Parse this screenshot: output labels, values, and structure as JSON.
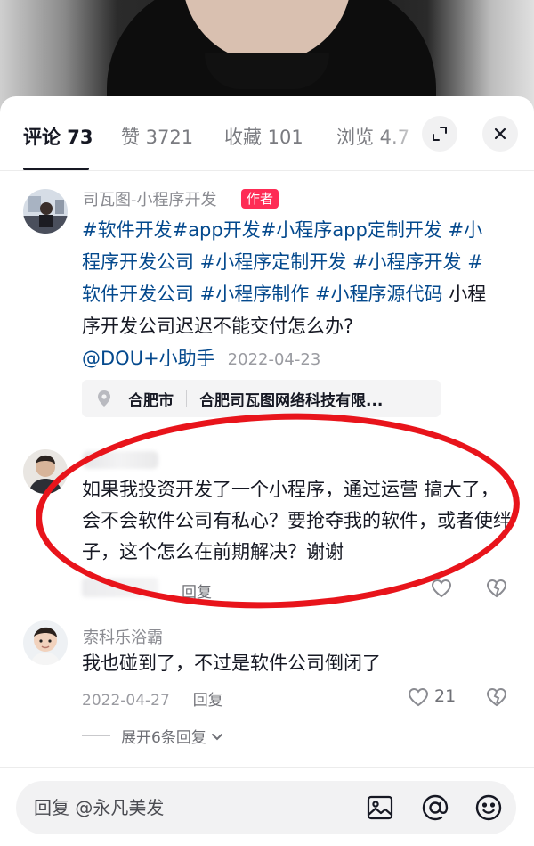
{
  "tabs": {
    "comments": "评论 73",
    "likes": "赞 3721",
    "favorites": "收藏 101",
    "views": "浏览 4.7"
  },
  "post": {
    "author": "司瓦图-小程序开发",
    "badge": "作者",
    "tags": "#软件开发#app开发#小程序app定制开发 #小程序开发公司 #小程序定制开发 #小程序开发 #软件开发公司 #小程序制作 #小程序源代码",
    "text": " 小程序开发公司迟迟不能交付怎么办?",
    "mention": "@DOU+小助手",
    "date": "2022-04-23",
    "location_city": "合肥市",
    "location_name": "合肥司瓦图网络科技有限..."
  },
  "comments": [
    {
      "text": "如果我投资开发了一个小程序，通过运营 搞大了，会不会软件公司有私心？要抢夺我的软件，或者使绊子，这个怎么在前期解决？谢谢",
      "reply_label": "回复"
    },
    {
      "user": "索科乐浴霸",
      "text": "我也碰到了，不过是软件公司倒闭了",
      "date": "2022-04-27",
      "reply_label": "回复",
      "likes": "21"
    }
  ],
  "expand_label": "展开6条回复",
  "input": {
    "placeholder": "回复 @永凡美发"
  },
  "colors": {
    "accent": "#fe2c55",
    "tag": "#04498d",
    "highlight": "#e8141b"
  },
  "icons": [
    "expand-icon",
    "close-icon",
    "location-pin-icon",
    "heart-icon",
    "broken-heart-icon",
    "chevron-down-icon",
    "image-icon",
    "at-icon",
    "emoji-icon"
  ]
}
